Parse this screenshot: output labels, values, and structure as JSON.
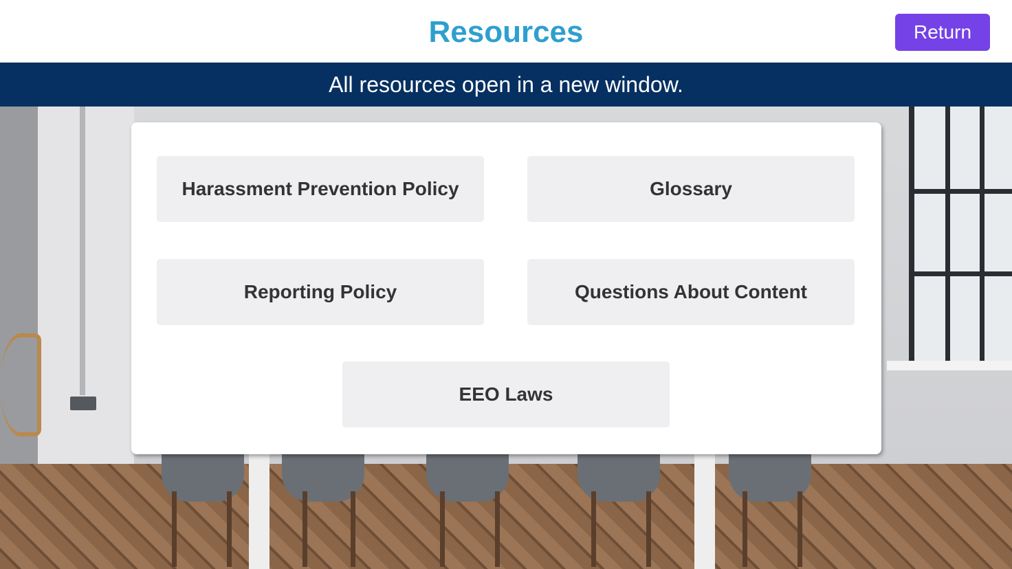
{
  "header": {
    "title": "Resources",
    "return_label": "Return"
  },
  "banner": {
    "text": "All resources open in a new window."
  },
  "resources": [
    {
      "label": "Harassment Prevention Policy"
    },
    {
      "label": "Glossary"
    },
    {
      "label": "Reporting Policy"
    },
    {
      "label": "Questions About Content"
    },
    {
      "label": "EEO Laws"
    }
  ],
  "colors": {
    "title": "#2e9fcf",
    "return_button": "#7442e6",
    "banner": "#063061",
    "resource_button": "#efeef0"
  }
}
